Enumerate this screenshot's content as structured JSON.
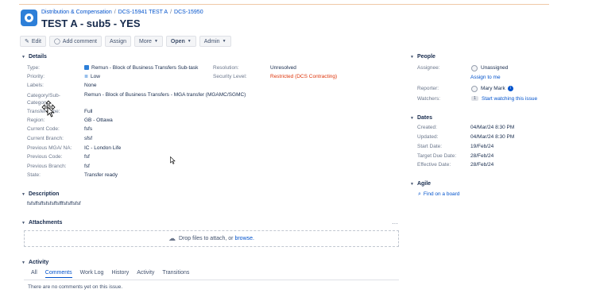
{
  "breadcrumb": {
    "items": [
      "Distribution & Compensation",
      "DCS-15941 TEST A",
      "DCS-15950"
    ],
    "separator": "/"
  },
  "issue": {
    "title": "TEST A - sub5 - YES"
  },
  "toolbar": {
    "edit": "Edit",
    "add_comment": "Add comment",
    "assign": "Assign",
    "more": "More",
    "open": "Open",
    "admin": "Admin"
  },
  "details": {
    "heading": "Details",
    "fields": [
      {
        "label": "Type:",
        "value": "Remun - Block of Business Transfers Sub-task"
      },
      {
        "label": "Priority:",
        "value": "Low"
      },
      {
        "label": "Labels:",
        "value": "None"
      },
      {
        "label": "Category/Sub-Category:",
        "value": "Remun - Block of Business Transfers - MGA transfer (MGAMC/SGMC)"
      },
      {
        "label": "Transfer Type:",
        "value": "Full"
      },
      {
        "label": "Region:",
        "value": "GB - Ottawa"
      },
      {
        "label": "Current Code:",
        "value": "fsfs"
      },
      {
        "label": "Current Branch:",
        "value": "sfsf"
      },
      {
        "label": "Previous MGA/ NA:",
        "value": "IC - London Life"
      },
      {
        "label": "Previous Code:",
        "value": "fsf"
      },
      {
        "label": "Previous Branch:",
        "value": "fsf"
      },
      {
        "label": "State:",
        "value": "Transfer ready"
      }
    ],
    "right_fields": [
      {
        "label": "Resolution:",
        "value": "Unresolved"
      },
      {
        "label": "Security Level:",
        "value": "Restricted (DCS Contracting)"
      }
    ]
  },
  "description": {
    "heading": "Description",
    "text": "fsfsffsffsfsfsffsfffsfsffsfsf"
  },
  "attachments": {
    "heading": "Attachments",
    "menu": "···",
    "drop_text": "Drop files to attach, or ",
    "browse": "browse."
  },
  "activity": {
    "heading": "Activity",
    "tabs": [
      "All",
      "Comments",
      "Work Log",
      "History",
      "Activity",
      "Transitions"
    ],
    "active_tab": "Comments",
    "empty": "There are no comments yet on this issue."
  },
  "people": {
    "heading": "People",
    "assignee_label": "Assignee:",
    "assignee": "Unassigned",
    "assign_to_me": "Assign to me",
    "reporter_label": "Reporter:",
    "reporter": "Mary Mark",
    "watchers_label": "Watchers:",
    "watchers_count": "1",
    "watch_link": "Start watching this issue"
  },
  "dates": {
    "heading": "Dates",
    "fields": [
      {
        "label": "Created:",
        "value": "04/Mar/24 8:30 PM"
      },
      {
        "label": "Updated:",
        "value": "04/Mar/24 8:30 PM"
      },
      {
        "label": "Start Date:",
        "value": "19/Feb/24"
      },
      {
        "label": "Target Due Date:",
        "value": "28/Feb/24"
      },
      {
        "label": "Effective Date:",
        "value": "28/Feb/24"
      }
    ]
  },
  "agile": {
    "heading": "Agile",
    "link": "Find on a board"
  },
  "colors": {
    "link": "#0052cc",
    "restricted": "#de350b",
    "project_avatar": "#2d7fd8"
  },
  "icons": {
    "edit": "pencil-icon",
    "comment": "comment-icon",
    "cloud": "cloud-upload-icon",
    "search": "search-icon",
    "info": "info-icon"
  }
}
